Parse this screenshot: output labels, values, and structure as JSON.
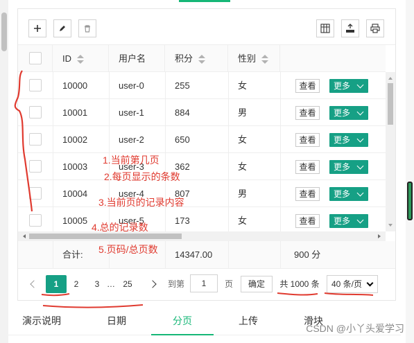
{
  "toolbar": {
    "left_icons": [
      "plus-icon",
      "edit-icon",
      "trash-icon"
    ],
    "right_icons": [
      "columns-icon",
      "export-icon",
      "print-icon"
    ]
  },
  "table": {
    "headers": {
      "id": "ID",
      "username": "用户名",
      "score": "积分",
      "gender": "性别"
    },
    "rows": [
      {
        "id": "10000",
        "username": "user-0",
        "score": "255",
        "gender": "女"
      },
      {
        "id": "10001",
        "username": "user-1",
        "score": "884",
        "gender": "男"
      },
      {
        "id": "10002",
        "username": "user-2",
        "score": "650",
        "gender": "女"
      },
      {
        "id": "10003",
        "username": "user-3",
        "score": "362",
        "gender": "女"
      },
      {
        "id": "10004",
        "username": "user-4",
        "score": "807",
        "gender": "男"
      },
      {
        "id": "10005",
        "username": "user-5",
        "score": "173",
        "gender": "女"
      }
    ],
    "view_label": "查看",
    "more_label": "更多",
    "accent_color": "#16a085"
  },
  "totals": {
    "label": "合计:",
    "score_total": "14347.00",
    "extra": "900 分"
  },
  "pager": {
    "pages": [
      "1",
      "2",
      "3",
      "…",
      "25"
    ],
    "active_page": "1",
    "goto_label": "到第",
    "goto_value": "1",
    "page_suffix": "页",
    "confirm_label": "确定",
    "total_label": "共 1000 条",
    "page_size": "40 条/页"
  },
  "tabs": [
    "演示说明",
    "日期",
    "分页",
    "上传",
    "滑块"
  ],
  "active_tab": "分页",
  "annotations": [
    "1.当前第几页",
    "2.每页显示的条数",
    "3.当前页的记录内容",
    "4.总的记录数",
    "5.页码/总页数"
  ],
  "watermark": "CSDN @小丫头爱学习"
}
